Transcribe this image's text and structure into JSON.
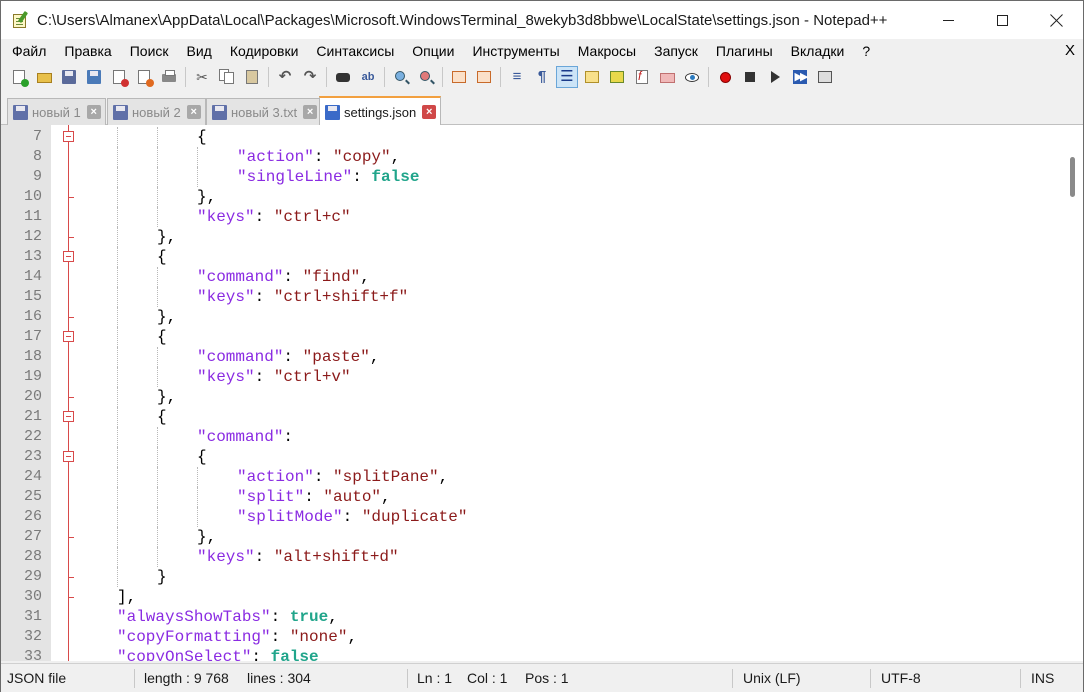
{
  "window": {
    "title": "C:\\Users\\Almanex\\AppData\\Local\\Packages\\Microsoft.WindowsTerminal_8wekyb3d8bbwe\\LocalState\\settings.json - Notepad++"
  },
  "menu": {
    "items": [
      "Файл",
      "Правка",
      "Поиск",
      "Вид",
      "Кодировки",
      "Синтаксисы",
      "Опции",
      "Инструменты",
      "Макросы",
      "Запуск",
      "Плагины",
      "Вкладки",
      "?"
    ],
    "close": "X"
  },
  "toolbar": {
    "icons": [
      "new-file-icon",
      "open-file-icon",
      "save-icon",
      "save-all-icon",
      "close-icon",
      "close-all-icon",
      "print-icon",
      "cut-icon",
      "copy-icon",
      "paste-icon",
      "undo-icon",
      "redo-icon",
      "find-icon",
      "replace-icon",
      "zoom-in-icon",
      "zoom-out-icon",
      "sync-vertical-icon",
      "sync-horizontal-icon",
      "word-wrap-icon",
      "show-all-chars-icon",
      "indent-guide-icon",
      "udl-icon",
      "doc-map-icon",
      "function-list-icon",
      "folder-workspace-icon",
      "monitoring-icon",
      "record-macro-icon",
      "stop-macro-icon",
      "play-macro-icon",
      "run-macro-multiple-icon",
      "save-macro-icon"
    ]
  },
  "tabs": [
    {
      "label": "новый 1",
      "active": false
    },
    {
      "label": "новый 2",
      "active": false
    },
    {
      "label": "новый 3.txt",
      "active": false
    },
    {
      "label": "settings.json",
      "active": true
    }
  ],
  "editor": {
    "lines": [
      {
        "n": "7",
        "indent": 3,
        "fold": "box",
        "tokens": [
          {
            "t": "{",
            "c": "p"
          }
        ]
      },
      {
        "n": "8",
        "indent": 4,
        "fold": "line",
        "tokens": [
          {
            "t": "\"action\"",
            "c": "k"
          },
          {
            "t": ": ",
            "c": "p"
          },
          {
            "t": "\"copy\"",
            "c": "s"
          },
          {
            "t": ",",
            "c": "p"
          }
        ]
      },
      {
        "n": "9",
        "indent": 4,
        "fold": "line",
        "tokens": [
          {
            "t": "\"singleLine\"",
            "c": "k"
          },
          {
            "t": ": ",
            "c": "p"
          },
          {
            "t": "false",
            "c": "b"
          }
        ]
      },
      {
        "n": "10",
        "indent": 3,
        "fold": "tick",
        "tokens": [
          {
            "t": "},",
            "c": "p"
          }
        ]
      },
      {
        "n": "11",
        "indent": 3,
        "fold": "line",
        "tokens": [
          {
            "t": "\"keys\"",
            "c": "k"
          },
          {
            "t": ": ",
            "c": "p"
          },
          {
            "t": "\"ctrl+c\"",
            "c": "s"
          }
        ]
      },
      {
        "n": "12",
        "indent": 2,
        "fold": "tick",
        "tokens": [
          {
            "t": "},",
            "c": "p"
          }
        ]
      },
      {
        "n": "13",
        "indent": 2,
        "fold": "box",
        "tokens": [
          {
            "t": "{",
            "c": "p"
          }
        ]
      },
      {
        "n": "14",
        "indent": 3,
        "fold": "line",
        "tokens": [
          {
            "t": "\"command\"",
            "c": "k"
          },
          {
            "t": ": ",
            "c": "p"
          },
          {
            "t": "\"find\"",
            "c": "s"
          },
          {
            "t": ",",
            "c": "p"
          }
        ]
      },
      {
        "n": "15",
        "indent": 3,
        "fold": "line",
        "tokens": [
          {
            "t": "\"keys\"",
            "c": "k"
          },
          {
            "t": ": ",
            "c": "p"
          },
          {
            "t": "\"ctrl+shift+f\"",
            "c": "s"
          }
        ]
      },
      {
        "n": "16",
        "indent": 2,
        "fold": "tick",
        "tokens": [
          {
            "t": "},",
            "c": "p"
          }
        ]
      },
      {
        "n": "17",
        "indent": 2,
        "fold": "box",
        "tokens": [
          {
            "t": "{",
            "c": "p"
          }
        ]
      },
      {
        "n": "18",
        "indent": 3,
        "fold": "line",
        "tokens": [
          {
            "t": "\"command\"",
            "c": "k"
          },
          {
            "t": ": ",
            "c": "p"
          },
          {
            "t": "\"paste\"",
            "c": "s"
          },
          {
            "t": ",",
            "c": "p"
          }
        ]
      },
      {
        "n": "19",
        "indent": 3,
        "fold": "line",
        "tokens": [
          {
            "t": "\"keys\"",
            "c": "k"
          },
          {
            "t": ": ",
            "c": "p"
          },
          {
            "t": "\"ctrl+v\"",
            "c": "s"
          }
        ]
      },
      {
        "n": "20",
        "indent": 2,
        "fold": "tick",
        "tokens": [
          {
            "t": "},",
            "c": "p"
          }
        ]
      },
      {
        "n": "21",
        "indent": 2,
        "fold": "box",
        "tokens": [
          {
            "t": "{",
            "c": "p"
          }
        ]
      },
      {
        "n": "22",
        "indent": 3,
        "fold": "line",
        "tokens": [
          {
            "t": "\"command\"",
            "c": "k"
          },
          {
            "t": ":",
            "c": "p"
          }
        ]
      },
      {
        "n": "23",
        "indent": 3,
        "fold": "box",
        "tokens": [
          {
            "t": "{",
            "c": "p"
          }
        ]
      },
      {
        "n": "24",
        "indent": 4,
        "fold": "line",
        "tokens": [
          {
            "t": "\"action\"",
            "c": "k"
          },
          {
            "t": ": ",
            "c": "p"
          },
          {
            "t": "\"splitPane\"",
            "c": "s"
          },
          {
            "t": ",",
            "c": "p"
          }
        ]
      },
      {
        "n": "25",
        "indent": 4,
        "fold": "line",
        "tokens": [
          {
            "t": "\"split\"",
            "c": "k"
          },
          {
            "t": ": ",
            "c": "p"
          },
          {
            "t": "\"auto\"",
            "c": "s"
          },
          {
            "t": ",",
            "c": "p"
          }
        ]
      },
      {
        "n": "26",
        "indent": 4,
        "fold": "line",
        "tokens": [
          {
            "t": "\"splitMode\"",
            "c": "k"
          },
          {
            "t": ": ",
            "c": "p"
          },
          {
            "t": "\"duplicate\"",
            "c": "s"
          }
        ]
      },
      {
        "n": "27",
        "indent": 3,
        "fold": "tick",
        "tokens": [
          {
            "t": "},",
            "c": "p"
          }
        ]
      },
      {
        "n": "28",
        "indent": 3,
        "fold": "line",
        "tokens": [
          {
            "t": "\"keys\"",
            "c": "k"
          },
          {
            "t": ": ",
            "c": "p"
          },
          {
            "t": "\"alt+shift+d\"",
            "c": "s"
          }
        ]
      },
      {
        "n": "29",
        "indent": 2,
        "fold": "tick",
        "tokens": [
          {
            "t": "}",
            "c": "p"
          }
        ]
      },
      {
        "n": "30",
        "indent": 1,
        "fold": "tick",
        "tokens": [
          {
            "t": "],",
            "c": "p"
          }
        ]
      },
      {
        "n": "31",
        "indent": 1,
        "fold": "line",
        "tokens": [
          {
            "t": "\"alwaysShowTabs\"",
            "c": "k"
          },
          {
            "t": ": ",
            "c": "p"
          },
          {
            "t": "true",
            "c": "b"
          },
          {
            "t": ",",
            "c": "p"
          }
        ]
      },
      {
        "n": "32",
        "indent": 1,
        "fold": "line",
        "tokens": [
          {
            "t": "\"copyFormatting\"",
            "c": "k"
          },
          {
            "t": ": ",
            "c": "p"
          },
          {
            "t": "\"none\"",
            "c": "s"
          },
          {
            "t": ",",
            "c": "p"
          }
        ]
      },
      {
        "n": "33",
        "indent": 1,
        "fold": "line",
        "tokens": [
          {
            "t": "\"copyOnSelect\"",
            "c": "k"
          },
          {
            "t": ": ",
            "c": "p"
          },
          {
            "t": "false",
            "c": "b"
          }
        ]
      }
    ]
  },
  "status": {
    "file_type": "JSON file",
    "length": "length : 9 768",
    "lines": "lines : 304",
    "ln": "Ln : 1",
    "col": "Col : 1",
    "pos": "Pos : 1",
    "eol": "Unix (LF)",
    "encoding": "UTF-8",
    "mode": "INS"
  },
  "colors": {
    "key": "#8a2be2",
    "string": "#8b1a1a",
    "boolean": "#21a58b",
    "fold_marker": "#d84a4a",
    "active_tab_accent": "#f2a040"
  }
}
